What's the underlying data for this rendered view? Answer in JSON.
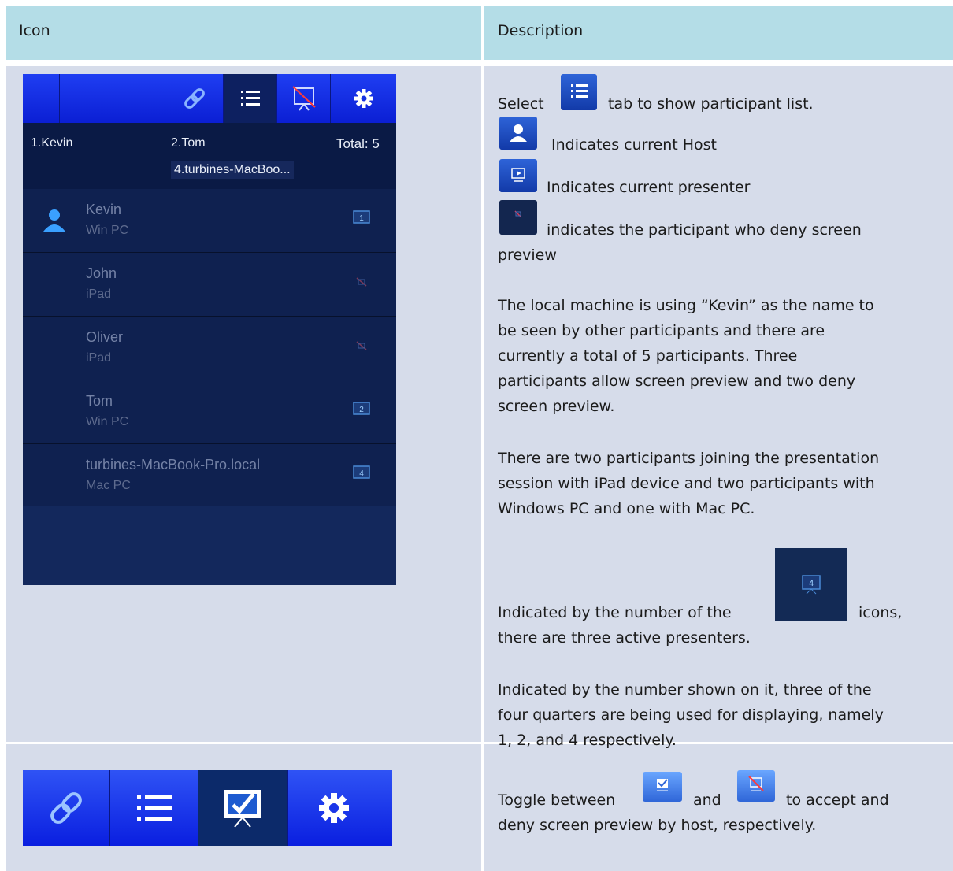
{
  "table": {
    "header": {
      "col1": "Icon",
      "col2": "Description"
    }
  },
  "phone": {
    "summary": {
      "p1": "1.Kevin",
      "p2": "2.Tom",
      "p4": "4.turbines-MacBoo...",
      "total": "Total: 5"
    },
    "participants": [
      {
        "name": "Kevin",
        "device": "Win PC",
        "indicator": "presenter-1-icon"
      },
      {
        "name": "John",
        "device": "iPad",
        "indicator": "deny-preview-icon"
      },
      {
        "name": "Oliver",
        "device": "iPad",
        "indicator": "deny-preview-icon"
      },
      {
        "name": "Tom",
        "device": "Win PC",
        "indicator": "presenter-2-icon"
      },
      {
        "name": "turbines-MacBook-Pro.local",
        "device": "Mac PC",
        "indicator": "presenter-4-icon"
      }
    ],
    "presenter_numbers": [
      "1",
      "2",
      "4"
    ],
    "tabs": [
      "link-icon",
      "list-icon",
      "deny-preview-icon",
      "gear-icon"
    ]
  },
  "description": {
    "select_a": "Select",
    "select_b": "tab to show participant list.",
    "host": "Indicates current Host",
    "presenter": "Indicates current presenter",
    "deny_a": "indicates the participant who deny screen",
    "deny_b": "preview",
    "para1": [
      "The local machine is using “Kevin” as the name to",
      "be seen by other participants and there are",
      "currently a total of 5 participants. Three",
      "participants allow screen preview and two deny",
      "screen preview."
    ],
    "para2": [
      "There are two participants joining the presentation",
      "session with iPad device and two participants with",
      "Windows PC and one with Mac PC."
    ],
    "indicated_a": "Indicated by the number of the",
    "indicated_b": "icons,",
    "indicated_c": "there are three active presenters.",
    "para4": [
      "Indicated by the number shown on it, three of the",
      "four quarters are being used for displaying, namely",
      "1, 2, and 4 respectively."
    ],
    "toggle_a": "Toggle between",
    "toggle_and": "and",
    "toggle_b": "to accept and",
    "toggle_c": "deny screen preview by host, respectively."
  },
  "colors": {
    "header_bg": "#b4dde7",
    "body_bg": "#d6dcea",
    "tab_blue": "#1f3ef2",
    "panel_dark": "#0d1f4a"
  }
}
